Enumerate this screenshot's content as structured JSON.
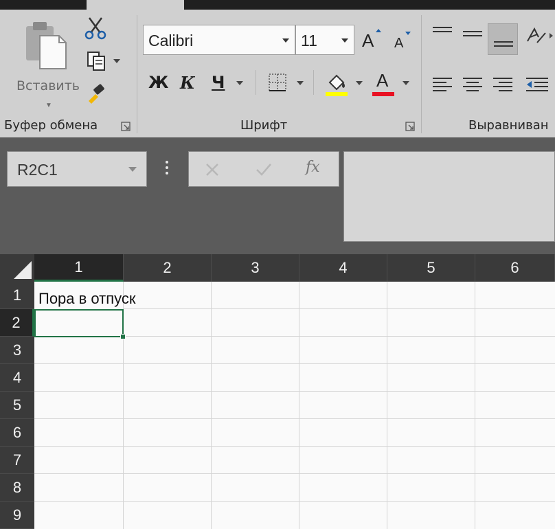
{
  "ribbon": {
    "clipboard": {
      "paste_label": "Вставить",
      "group_label": "Буфер обмена"
    },
    "font": {
      "font_name": "Calibri",
      "font_size": "11",
      "bold_label": "Ж",
      "italic_label": "К",
      "underline_label": "Ч",
      "grow_label": "A",
      "shrink_label": "A",
      "font_color_label": "A",
      "group_label": "Шрифт",
      "highlight_color": "#ffff00",
      "font_color": "#e81123"
    },
    "alignment": {
      "group_label": "Выравниван"
    }
  },
  "formula_bar": {
    "name_box": "R2C1",
    "fx_label": "fx",
    "formula": ""
  },
  "grid": {
    "columns": [
      "1",
      "2",
      "3",
      "4",
      "5",
      "6"
    ],
    "rows": [
      "1",
      "2",
      "3",
      "4",
      "5",
      "6",
      "7",
      "8",
      "9"
    ],
    "selected_column": "1",
    "selected_row": "2",
    "cells": {
      "R1C1": "Пора в отпуск"
    }
  },
  "colors": {
    "accent": "#217346",
    "ribbon_bg": "#d0d0d0",
    "header_bg": "#3a3a3a"
  }
}
